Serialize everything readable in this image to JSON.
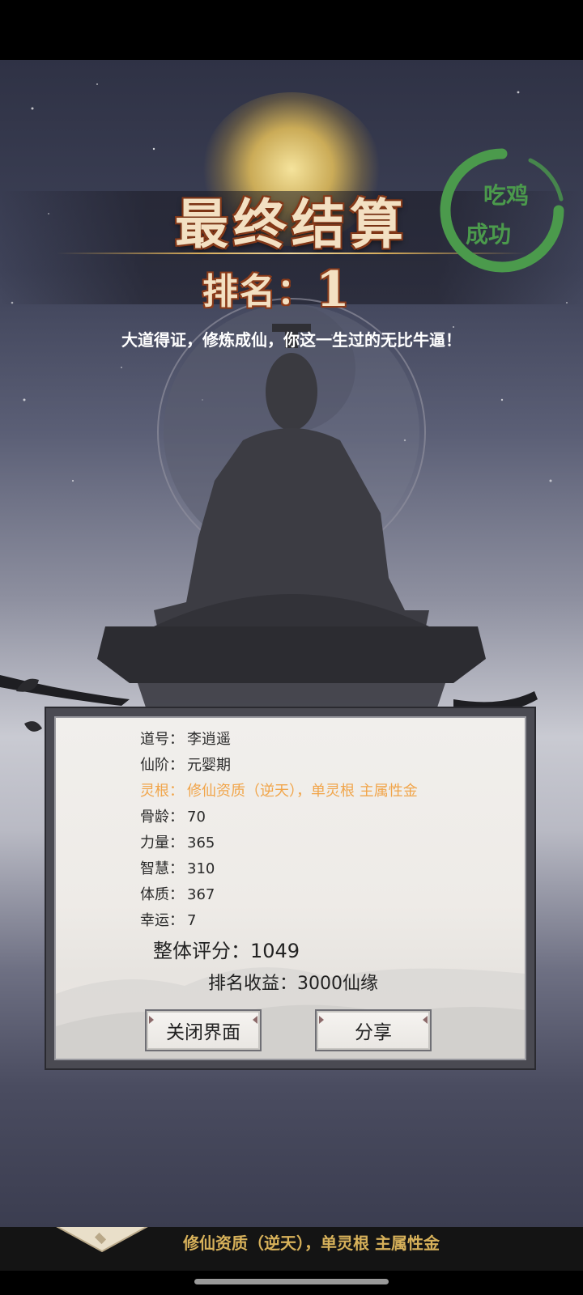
{
  "header": {
    "title": "最终结算",
    "rank_label": "排名：",
    "rank_value": "1",
    "subtitle": "大道得证，修炼成仙，你这一生过的无比牛逼！",
    "stamp_lines": [
      "吃鸡",
      "成功"
    ]
  },
  "stats": [
    {
      "label": "道号：",
      "value": "李逍遥",
      "highlight": false
    },
    {
      "label": "仙阶：",
      "value": "元婴期",
      "highlight": false
    },
    {
      "label": "灵根：",
      "value": "修仙资质（逆天），单灵根 主属性金",
      "highlight": true
    },
    {
      "label": "骨龄：",
      "value": "70",
      "highlight": false
    },
    {
      "label": "力量：",
      "value": "365",
      "highlight": false
    },
    {
      "label": "智慧：",
      "value": "310",
      "highlight": false
    },
    {
      "label": "体质：",
      "value": "367",
      "highlight": false
    },
    {
      "label": "幸运：",
      "value": "7",
      "highlight": false
    }
  ],
  "score": {
    "label": "整体评分：",
    "value": "1049"
  },
  "gain": {
    "label": "排名收益：",
    "value": "3000仙缘"
  },
  "buttons": {
    "close": "关闭界面",
    "share": "分享"
  },
  "bottom_strip": {
    "text": "修仙资质（逆天），单灵根 主属性金"
  },
  "colors": {
    "highlight": "#f1a54a",
    "stamp": "#4b9a4c",
    "title_fill": "#f3e0c2",
    "title_outline": "#8b3b1a"
  }
}
